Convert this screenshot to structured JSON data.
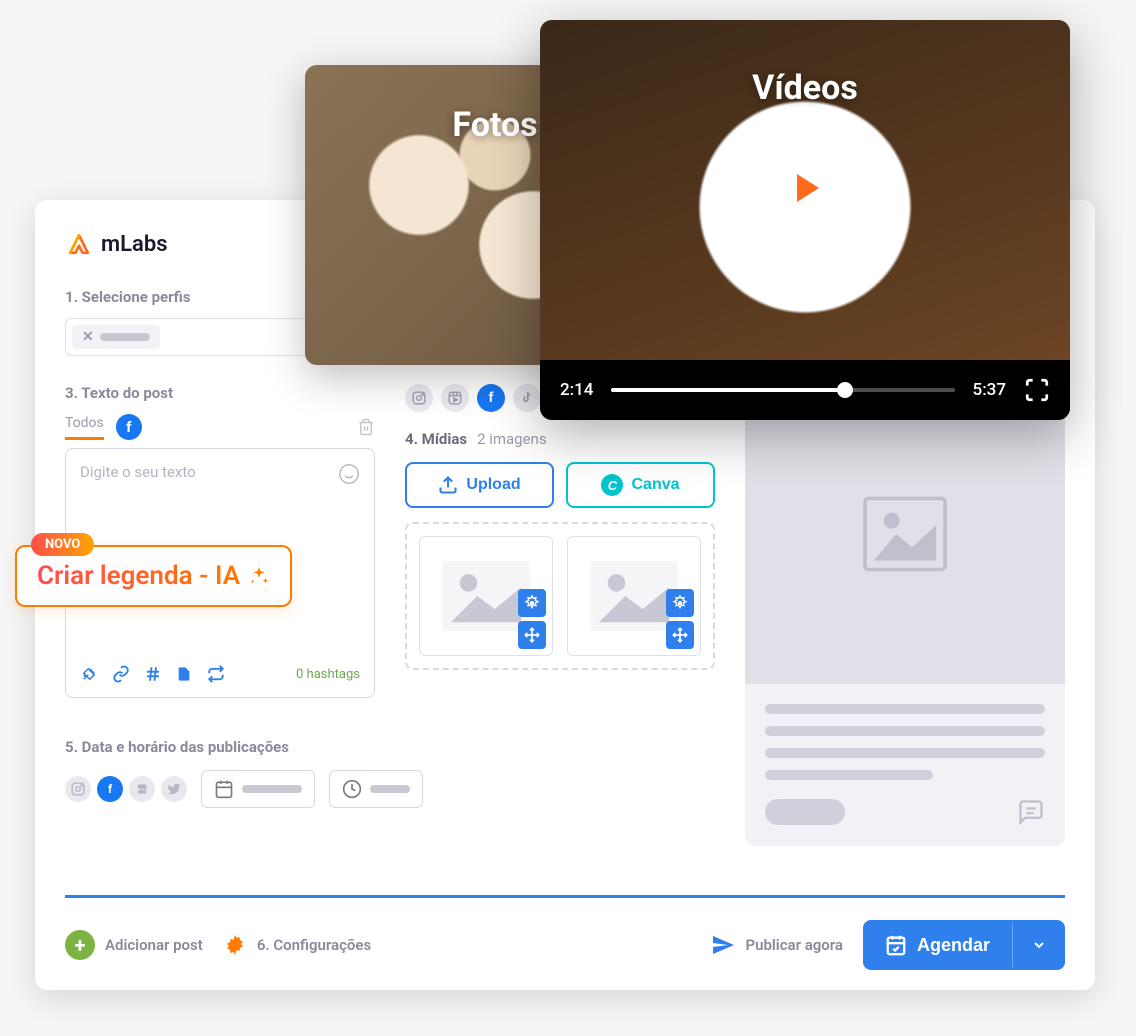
{
  "brand": {
    "name": "mLabs"
  },
  "steps": {
    "s1": "1. Selecione perfis",
    "s3": "3. Texto do post",
    "s4": "4. Mídias",
    "s4_count": "2 imagens",
    "s5": "5. Data e horário das publicações",
    "s6": "6. Configurações"
  },
  "editor": {
    "tab_all": "Todos",
    "placeholder": "Digite o seu texto",
    "hashtags": "0 hashtags"
  },
  "ia": {
    "badge": "NOVO",
    "text": "Criar legenda - IA"
  },
  "media_buttons": {
    "upload": "Upload",
    "canva": "Canva"
  },
  "footer": {
    "add_post": "Adicionar post",
    "publish_now": "Publicar agora",
    "schedule": "Agendar"
  },
  "float": {
    "photos": "Fotos",
    "videos": "Vídeos",
    "time_current": "2:14",
    "time_total": "5:37"
  },
  "colors": {
    "primary_blue": "#2f80ed",
    "accent_orange": "#ff7a00",
    "canva_teal": "#00c4cc",
    "add_green": "#7cb342"
  }
}
